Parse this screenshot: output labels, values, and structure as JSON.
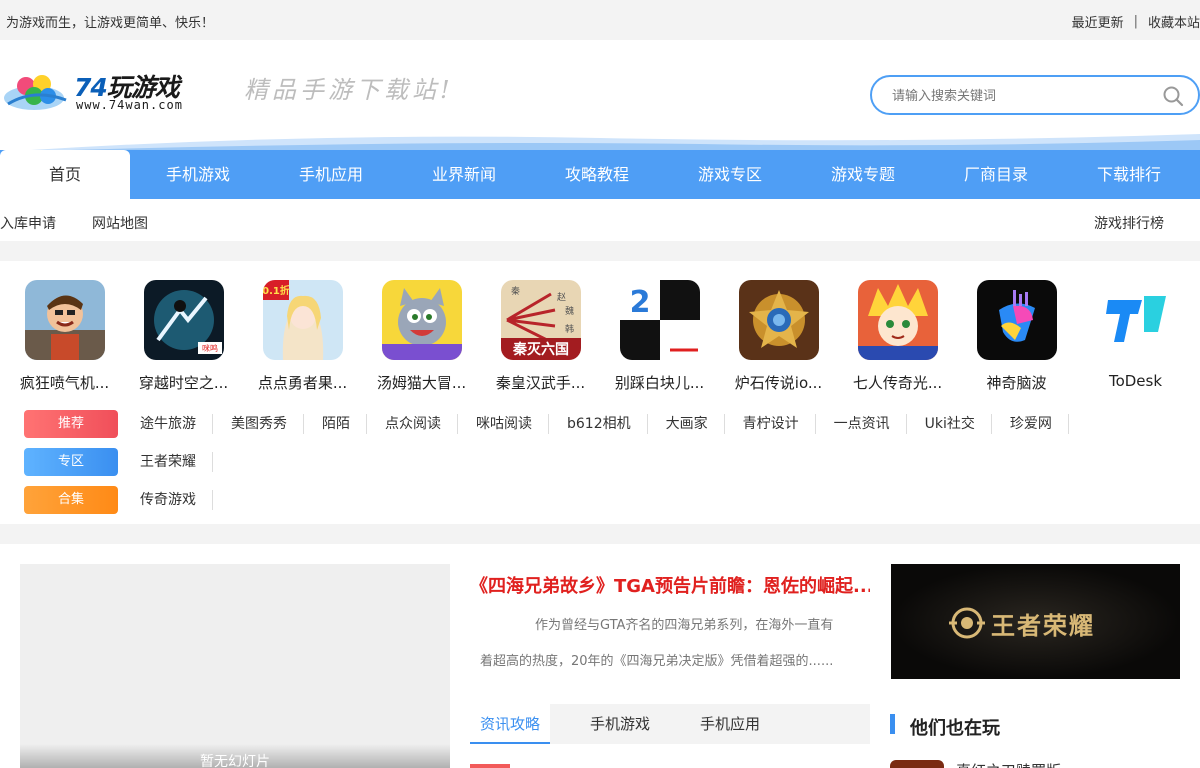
{
  "topbar": {
    "slogan": "为游戏而生，让游戏更简单、快乐！",
    "recent": "最近更新",
    "sep": "|",
    "bookmark": "收藏本站"
  },
  "header": {
    "logo_num": "74",
    "logo_name": "玩游戏",
    "logo_domain": "www.74wan.com",
    "tagline": "精品手游下载站!",
    "search_placeholder": "请输入搜索关键词"
  },
  "nav": [
    "首页",
    "手机游戏",
    "手机应用",
    "业界新闻",
    "攻略教程",
    "游戏专区",
    "游戏专题",
    "厂商目录",
    "下载排行"
  ],
  "subnav": {
    "apply": "入库申请",
    "sitemap": "网站地图",
    "rank": "游戏排行榜"
  },
  "apps": [
    {
      "label": "疯狂喷气机..."
    },
    {
      "label": "穿越时空之..."
    },
    {
      "label": "点点勇者果..."
    },
    {
      "label": "汤姆猫大冒..."
    },
    {
      "label": "秦皇汉武手..."
    },
    {
      "label": "别踩白块儿..."
    },
    {
      "label": "炉石传说io..."
    },
    {
      "label": "七人传奇光..."
    },
    {
      "label": "神奇脑波"
    },
    {
      "label": "ToDesk"
    }
  ],
  "app_icon_text": {
    "chuanyue_badge": "咪鸣",
    "diandian_badge": "0.1折",
    "qin_title": "秦灭六国",
    "qin_side1": "秦",
    "qin_side2": "赵",
    "qin_side3": "魏",
    "qin_side4": "韩",
    "bai_num": "2"
  },
  "tag_rows": [
    {
      "tag": "推荐",
      "links": [
        "途牛旅游",
        "美图秀秀",
        "陌陌",
        "点众阅读",
        "咪咕阅读",
        "b612相机",
        "大画家",
        "青柠设计",
        "一点资讯",
        "Uki社交",
        "珍爱网"
      ]
    },
    {
      "tag": "专区",
      "links": [
        "王者荣耀"
      ]
    },
    {
      "tag": "合集",
      "links": [
        "传奇游戏"
      ]
    }
  ],
  "slider": {
    "caption": "暂无幻灯片"
  },
  "news": {
    "headline": "《四海兄弟故乡》TGA预告片前瞻：恩佐的崛起...",
    "summary1": "作为曾经与GTA齐名的四海兄弟系列，在海外一直有",
    "summary2": "着超高的热度，20年的《四海兄弟决定版》凭借着超强的......"
  },
  "tabs": [
    "资讯攻略",
    "手机游戏",
    "手机应用"
  ],
  "banner": {
    "title": "王者荣耀"
  },
  "playing": {
    "title": "他们也在玩",
    "first": "真红之刃赎罪版"
  },
  "colors": {
    "accent": "#4f9ef5",
    "headline": "#e0211f",
    "tab_active": "#3a8ff0"
  }
}
